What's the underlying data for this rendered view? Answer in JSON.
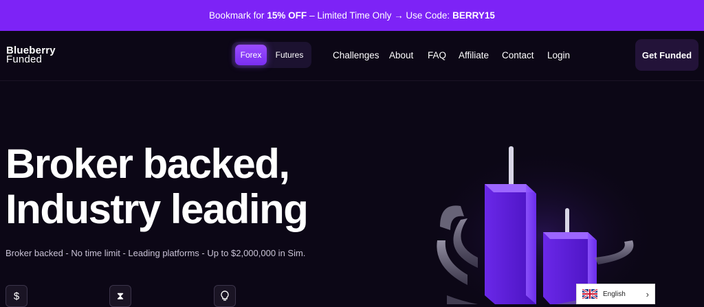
{
  "promo": {
    "prefix": "Bookmark for",
    "highlight": "15% OFF",
    "middle": "– Limited Time Only → Use Code:",
    "code": "BERRY15"
  },
  "logo": {
    "line1": "Blueberry",
    "line2": "Funded"
  },
  "market_toggle": {
    "forex": "Forex",
    "futures": "Futures",
    "selected": "Forex"
  },
  "nav": {
    "challenges": "Challenges",
    "about": "About",
    "faq": "FAQ",
    "affiliate": "Affiliate",
    "contact": "Contact",
    "login": "Login"
  },
  "cta": {
    "label": "Get Funded"
  },
  "hero": {
    "title_line1": "Broker backed,",
    "title_line2": "Industry leading",
    "subtitle": "Broker backed - No time limit - Leading platforms - Up to $2,000,000 in Sim."
  },
  "features": {
    "icons": [
      "dollar-icon",
      "hourglass-icon",
      "lightbulb-icon"
    ]
  },
  "language": {
    "label": "English",
    "flag": "uk-flag-icon"
  },
  "colors": {
    "accent": "#7d23f6",
    "background": "#0c0716",
    "button": "#231339"
  }
}
